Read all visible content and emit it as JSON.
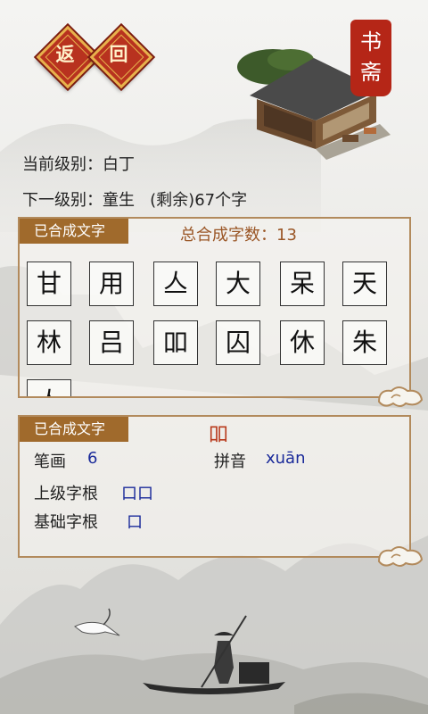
{
  "header": {
    "back_label": "返",
    "back2_label": "回",
    "seal_text": "书斋"
  },
  "level": {
    "current_text": "当前级别：白丁",
    "next_text": "下一级别：童生   (剩余)67个字"
  },
  "composed": {
    "tag_label": "已合成文字",
    "total_text": "总合成字数：13",
    "chars": [
      "甘",
      "用",
      "亼",
      "大",
      "呆",
      "天",
      "林",
      "吕",
      "吅",
      "囚",
      "休",
      "朱",
      "亼"
    ]
  },
  "detail": {
    "tag_label": "已合成文字",
    "char": "吅",
    "stroke_label": "笔画",
    "stroke_value": "6",
    "pinyin_label": "拼音",
    "pinyin_value": "xuān",
    "upper_label": "上级字根",
    "upper_value": "口口",
    "base_label": "基础字根",
    "base_value": "口"
  },
  "colors": {
    "accent_red": "#b8321f",
    "tag_brown": "#a06a2c",
    "value_blue": "#1a2a9a"
  }
}
